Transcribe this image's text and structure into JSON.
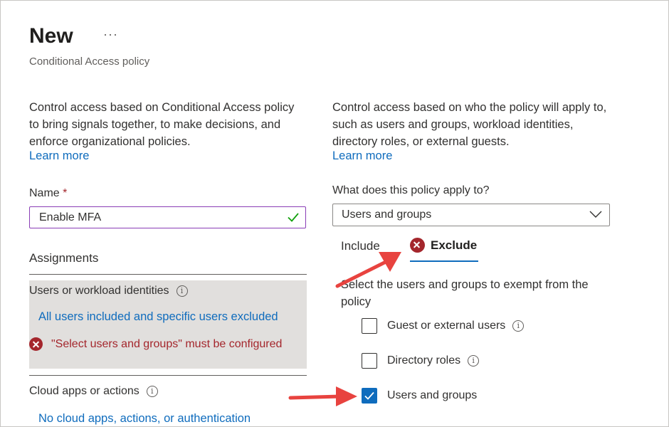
{
  "header": {
    "title": "New",
    "more_glyph": "···",
    "subtitle": "Conditional Access policy"
  },
  "left": {
    "description": "Control access based on Conditional Access policy to bring signals together, to make decisions, and enforce organizational policies.",
    "learn_more": "Learn more",
    "name_label": "Name",
    "required_mark": "*",
    "name_value": "Enable MFA",
    "assignments_heading": "Assignments",
    "users_title": "Users or workload identities",
    "users_summary": "All users included and specific users excluded",
    "users_error": "\"Select users and groups\" must be configured",
    "cloud_title": "Cloud apps or actions",
    "cloud_summary": "No cloud apps, actions, or authentication"
  },
  "right": {
    "description": "Control access based on who the policy will apply to, such as users and groups, workload identities, directory roles, or external guests.",
    "learn_more": "Learn more",
    "apply_label": "What does this policy apply to?",
    "apply_value": "Users and groups",
    "tabs": [
      {
        "label": "Include",
        "active": false
      },
      {
        "label": "Exclude",
        "active": true
      }
    ],
    "exempt_text": "Select the users and groups to exempt from the policy",
    "options": [
      {
        "label": "Guest or external users",
        "checked": false,
        "info": true
      },
      {
        "label": "Directory roles",
        "checked": false,
        "info": true
      },
      {
        "label": "Users and groups",
        "checked": true,
        "info": false
      }
    ]
  },
  "colors": {
    "accent": "#0f6cbd",
    "error": "#a4262c",
    "annotation_arrow": "#e8433f",
    "input_focus": "#8a3db6",
    "valid_check": "#13a10e"
  }
}
